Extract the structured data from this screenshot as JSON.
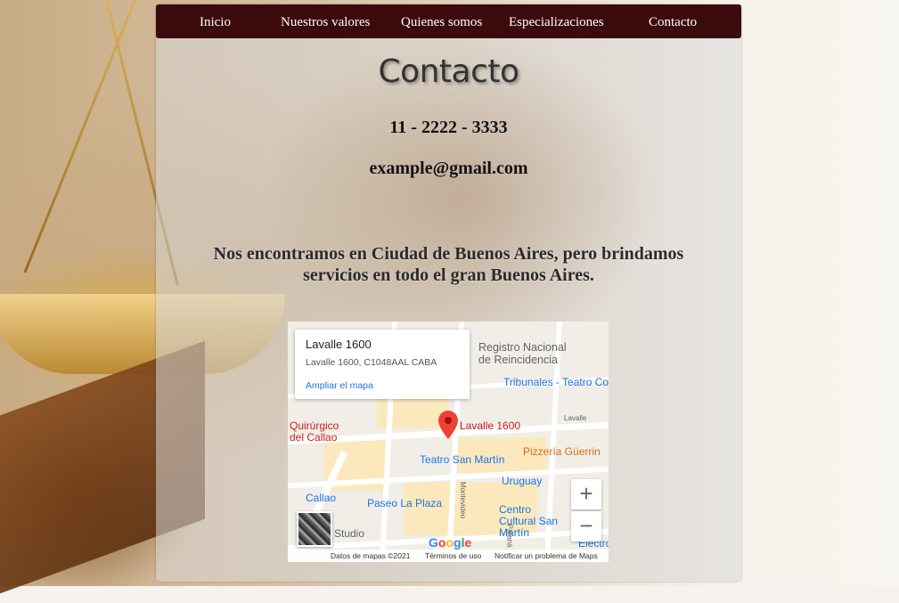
{
  "nav": {
    "items": [
      "Inicio",
      "Nuestros valores",
      "Quienes somos",
      "Especializaciones",
      "Contacto"
    ]
  },
  "contact": {
    "title": "Contacto",
    "phone": "11 - 2222 - 3333",
    "email": "example@gmail.com",
    "description": "Nos encontramos en Ciudad de Buenos Aires, pero brindamos servicios en todo el gran Buenos Aires."
  },
  "map": {
    "info_title": "Lavalle 1600",
    "info_address": "Lavalle 1600, C1048AAL CABA",
    "info_link": "Ampliar el mapa",
    "pin_label": "Lavalle 1600",
    "places": {
      "registro": "Registro Nacional de Reincidencia",
      "tribunales": "Tribunales - Teatro Co",
      "quirurgico": "Quirúrgico del Callao",
      "teatro_sm": "Teatro San Martín",
      "pizzeria": "Pizzería Güerrin",
      "uruguay": "Uruguay",
      "callao": "Callao",
      "paseo": "Paseo La Plaza",
      "centro_cultural": "Centro Cultural San Martín",
      "studio": "Studio",
      "electro": "Electro",
      "lavalle_street": "Lavalle",
      "montevideo_street": "Montevideo",
      "parana_street": "Paraná"
    },
    "zoom_in": "+",
    "zoom_out": "−",
    "google_logo": "Google",
    "footer": {
      "data": "Datos de mapas ©2021",
      "terms": "Términos de uso",
      "report": "Notificar un problema de Maps"
    }
  },
  "colors": {
    "nav_bg": "#3b0a0d",
    "link_blue": "#1a73e8",
    "pin_red": "#ea4335"
  }
}
